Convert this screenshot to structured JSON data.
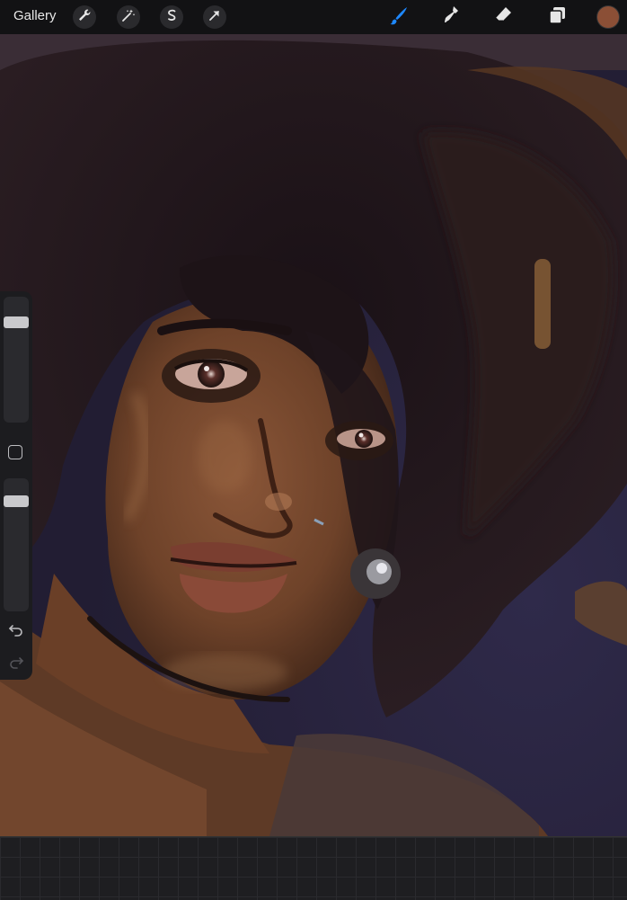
{
  "topbar": {
    "gallery_label": "Gallery",
    "left_tools": [
      {
        "icon": "wrench-icon",
        "name": "actions"
      },
      {
        "icon": "magic-wand-icon",
        "name": "adjustments"
      },
      {
        "icon": "selection-s-icon",
        "name": "selection"
      },
      {
        "icon": "arrow-cursor-icon",
        "name": "transform"
      }
    ],
    "right_tools": [
      {
        "icon": "brush-icon",
        "name": "brush",
        "active": true
      },
      {
        "icon": "smudge-icon",
        "name": "smudge"
      },
      {
        "icon": "eraser-icon",
        "name": "eraser"
      },
      {
        "icon": "layers-icon",
        "name": "layers"
      }
    ],
    "active_tool_color": "#1e88ff",
    "current_color": "#8b4f36"
  },
  "sidebar": {
    "brush_size_level": 0.85,
    "opacity_level": 0.88,
    "modify_icon": "square-icon",
    "undo_icon": "undo-arrow-icon",
    "redo_icon": "redo-arrow-icon"
  },
  "canvas": {
    "description_icon": "painting-canvas",
    "background_color": "#2b2640",
    "skin_color": "#7a4a2e",
    "hair_color": "#1f1418"
  }
}
